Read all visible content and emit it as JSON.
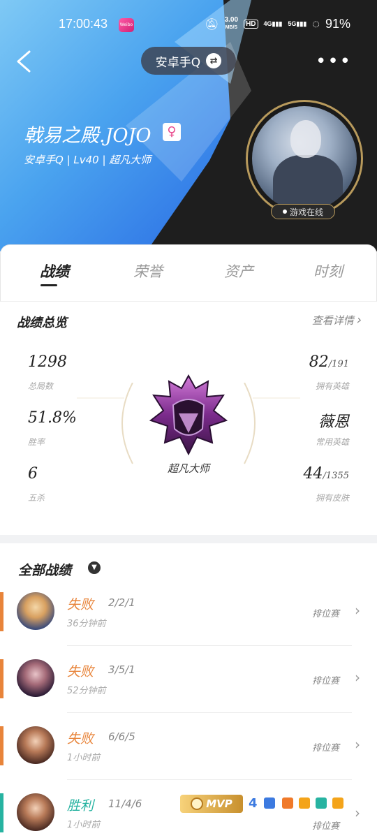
{
  "status_bar": {
    "time": "17:00:43",
    "app_badge": "Weibo",
    "net_speed": "3.00",
    "net_unit": "MB/S",
    "hd": "HD",
    "sig1": "4G",
    "sig2": "5G",
    "battery": "91%"
  },
  "header": {
    "server": "安卓手Q",
    "player_name": "戟易之殿.JOJO",
    "player_sub": "安卓手Q | Lv40 | 超凡大师",
    "online_status": "游戏在线"
  },
  "tabs": [
    "战绩",
    "荣誉",
    "资产",
    "时刻"
  ],
  "overview": {
    "title": "战绩总览",
    "detail_link": "查看详情",
    "stats_left": [
      {
        "value": "1298",
        "label": "总局数"
      },
      {
        "value": "51.8%",
        "label": "胜率"
      },
      {
        "value": "6",
        "label": "五杀"
      }
    ],
    "stats_right": [
      {
        "value": "82",
        "suffix": "/191",
        "label": "拥有英雄"
      },
      {
        "value": "薇恩",
        "suffix": "",
        "label": "常用英雄"
      },
      {
        "value": "44",
        "suffix": "/1355",
        "label": "拥有皮肤"
      }
    ],
    "rank_name": "超凡大师"
  },
  "matches_title": "全部战绩",
  "matches": [
    {
      "result": "失败",
      "kda": "2/2/1",
      "duration": "36分钟前",
      "mode": "排位赛",
      "result_color": "#e8843a"
    },
    {
      "result": "失败",
      "kda": "3/5/1",
      "duration": "52分钟前",
      "mode": "排位赛",
      "result_color": "#e8843a"
    },
    {
      "result": "失败",
      "kda": "6/6/5",
      "duration": "1小时前",
      "mode": "排位赛",
      "result_color": "#e8843a"
    },
    {
      "result": "胜利",
      "kda": "11/4/6",
      "duration": "1小时前",
      "mode": "排位赛",
      "result_color": "#27b3a1"
    }
  ],
  "mvp_label": "MVP",
  "mvp_count": "4",
  "colors": {
    "loss": "#e8843a",
    "win": "#27b3a1",
    "gold": "#b89a5c"
  }
}
